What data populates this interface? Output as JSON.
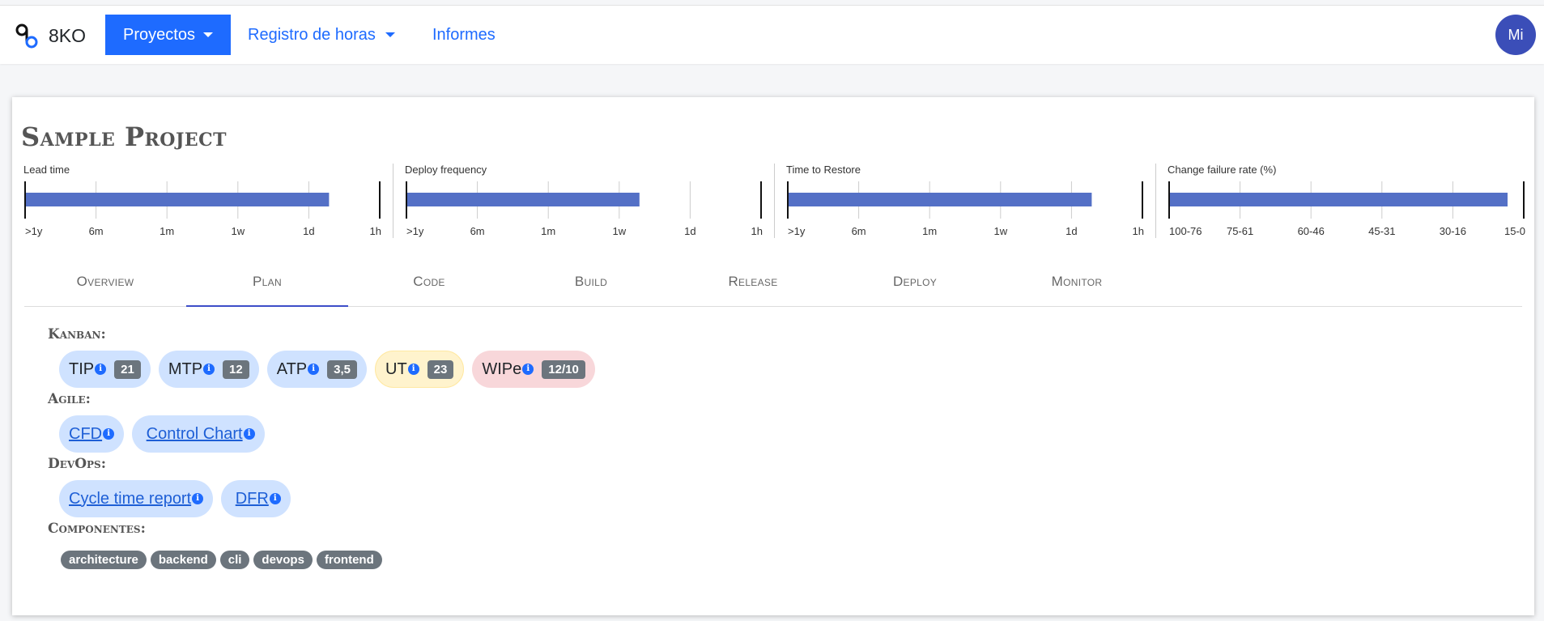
{
  "nav": {
    "brand": "8KO",
    "items": [
      {
        "label": "Proyectos",
        "active": true,
        "dropdown": true
      },
      {
        "label": "Registro de horas",
        "active": false,
        "dropdown": true
      },
      {
        "label": "Informes",
        "active": false,
        "dropdown": false
      }
    ],
    "avatar": "Mi",
    "accent_color": "#1e6bff"
  },
  "project": {
    "title": "Sample Project"
  },
  "metrics": [
    {
      "label": "Lead time",
      "ticks": [
        ">1y",
        "6m",
        "1m",
        "1w",
        "1d",
        "1h"
      ],
      "value": "1d"
    },
    {
      "label": "Deploy frequency",
      "ticks": [
        ">1y",
        "6m",
        "1m",
        "1w",
        "1d",
        "1h"
      ],
      "value": "1w"
    },
    {
      "label": "Time to Restore",
      "ticks": [
        ">1y",
        "6m",
        "1m",
        "1w",
        "1d",
        "1h"
      ],
      "value": "1d"
    },
    {
      "label": "Change failure rate (%)",
      "ticks": [
        "100-76",
        "75-61",
        "60-46",
        "45-31",
        "30-16",
        "15-0"
      ],
      "value": "15-0"
    }
  ],
  "metric_bar_color": "#5470c6",
  "tabs": [
    "Overview",
    "Plan",
    "Code",
    "Build",
    "Release",
    "Deploy",
    "Monitor"
  ],
  "active_tab": "Plan",
  "sections": {
    "kanban": {
      "title": "Kanban:",
      "items": [
        {
          "label": "TIP",
          "count": "21",
          "status": "primary"
        },
        {
          "label": "MTP",
          "count": "12",
          "status": "primary"
        },
        {
          "label": "ATP",
          "count": "3,5",
          "status": "primary"
        },
        {
          "label": "UT",
          "count": "23",
          "status": "warning"
        },
        {
          "label": "WIPe",
          "count": "12/10",
          "status": "danger"
        }
      ]
    },
    "agile": {
      "title": "Agile:",
      "items": [
        "CFD",
        "Control Chart"
      ]
    },
    "devops": {
      "title": "DevOps:",
      "items": [
        "Cycle time report",
        "DFR"
      ]
    },
    "componentes": {
      "title": "Componentes:",
      "tags": [
        "architecture",
        "backend",
        "cli",
        "devops",
        "frontend"
      ]
    }
  },
  "info_icon": "i"
}
